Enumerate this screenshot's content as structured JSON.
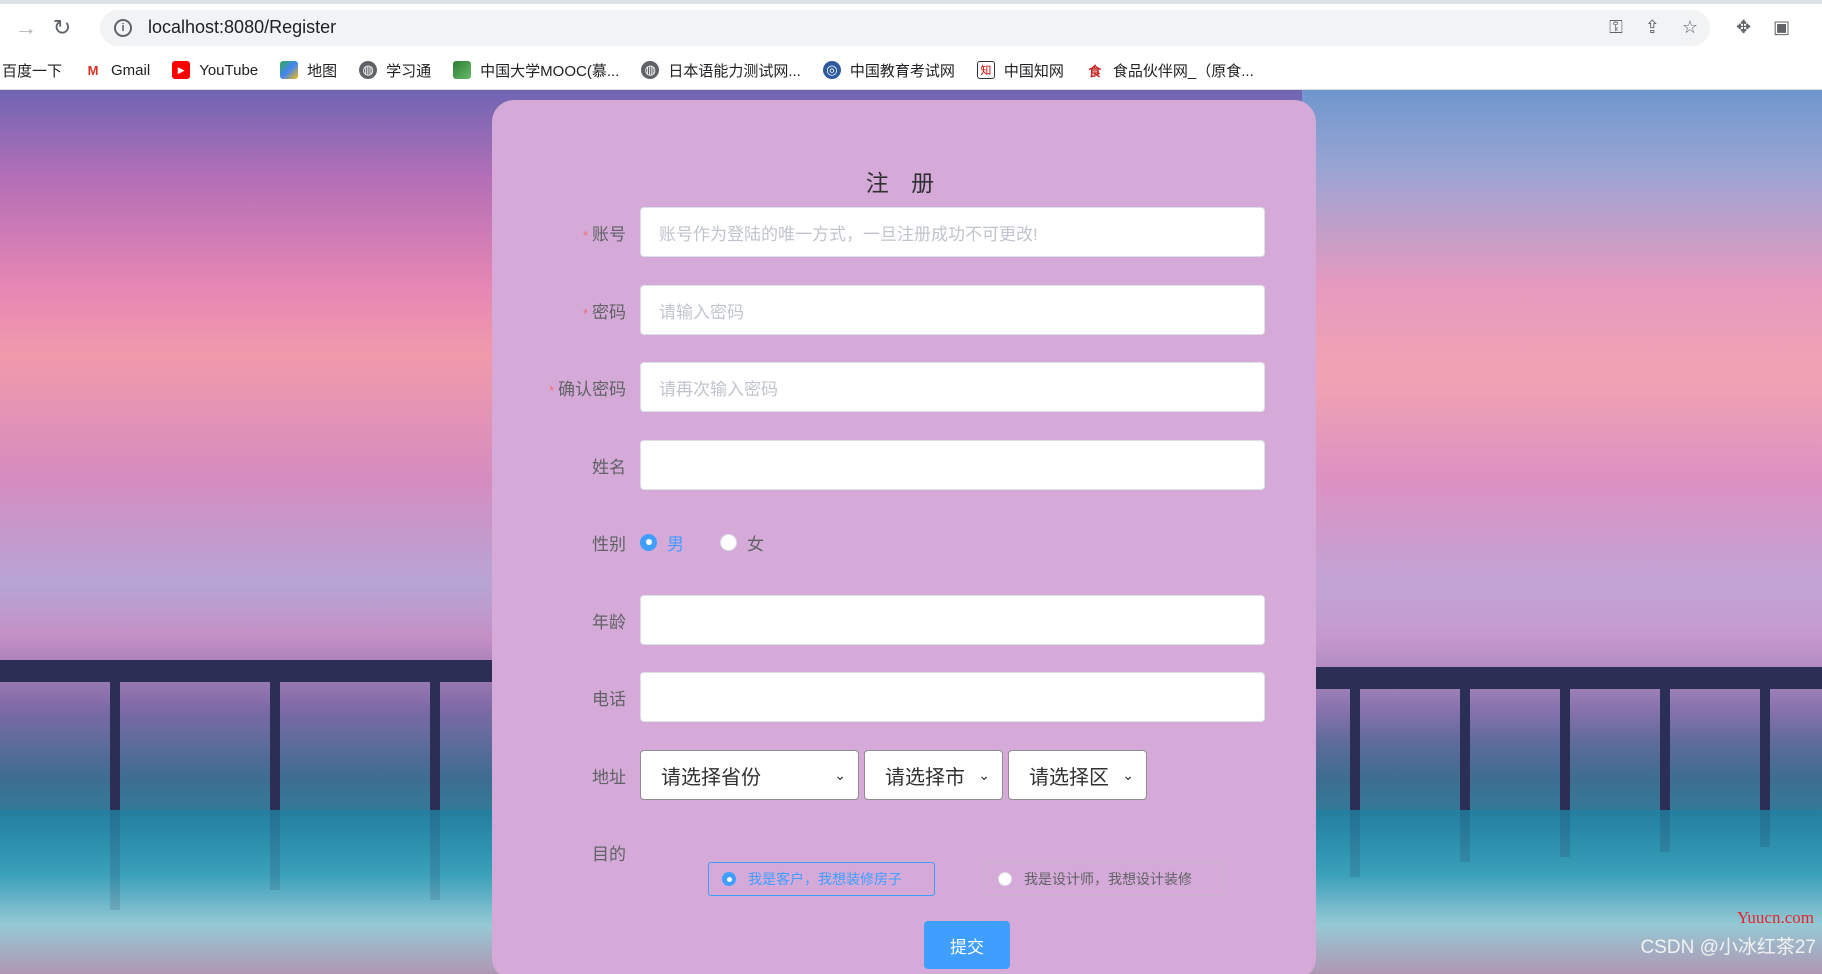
{
  "browser": {
    "url": "localhost:8080/Register",
    "bookmarks": [
      {
        "label": "百度一下",
        "icon": "baidu-icon"
      },
      {
        "label": "Gmail",
        "icon": "gmail-icon"
      },
      {
        "label": "YouTube",
        "icon": "youtube-icon"
      },
      {
        "label": "地图",
        "icon": "maps-icon"
      },
      {
        "label": "学习通",
        "icon": "globe-icon"
      },
      {
        "label": "中国大学MOOC(慕...",
        "icon": "mooc-icon"
      },
      {
        "label": "日本语能力测试网...",
        "icon": "globe-icon"
      },
      {
        "label": "中国教育考试网",
        "icon": "neea-icon"
      },
      {
        "label": "中国知网",
        "icon": "cnki-icon"
      },
      {
        "label": "食品伙伴网_（原食...",
        "icon": "food-icon"
      }
    ]
  },
  "form": {
    "title": "注 册",
    "required_mark": "*",
    "account": {
      "label": "账号",
      "placeholder": "账号作为登陆的唯一方式，一旦注册成功不可更改!"
    },
    "password": {
      "label": "密码",
      "placeholder": "请输入密码"
    },
    "confirm_password": {
      "label": "确认密码",
      "placeholder": "请再次输入密码"
    },
    "name": {
      "label": "姓名",
      "placeholder": ""
    },
    "gender": {
      "label": "性别",
      "options": [
        "男",
        "女"
      ],
      "selected": "男"
    },
    "age": {
      "label": "年龄",
      "placeholder": ""
    },
    "phone": {
      "label": "电话",
      "placeholder": ""
    },
    "address": {
      "label": "地址",
      "province": "请选择省份",
      "city": "请选择市",
      "district": "请选择区"
    },
    "purpose": {
      "label": "目的",
      "options": [
        "我是客户，我想装修房子",
        "我是设计师，我想设计装修"
      ],
      "selected": "我是客户，我想装修房子"
    },
    "submit": "提交"
  },
  "watermarks": {
    "site": "Yuucn.com",
    "csdn": "CSDN @小冰红茶27"
  },
  "colors": {
    "accent": "#409eff",
    "card": "#d5aad8",
    "required": "#f56c6c"
  }
}
